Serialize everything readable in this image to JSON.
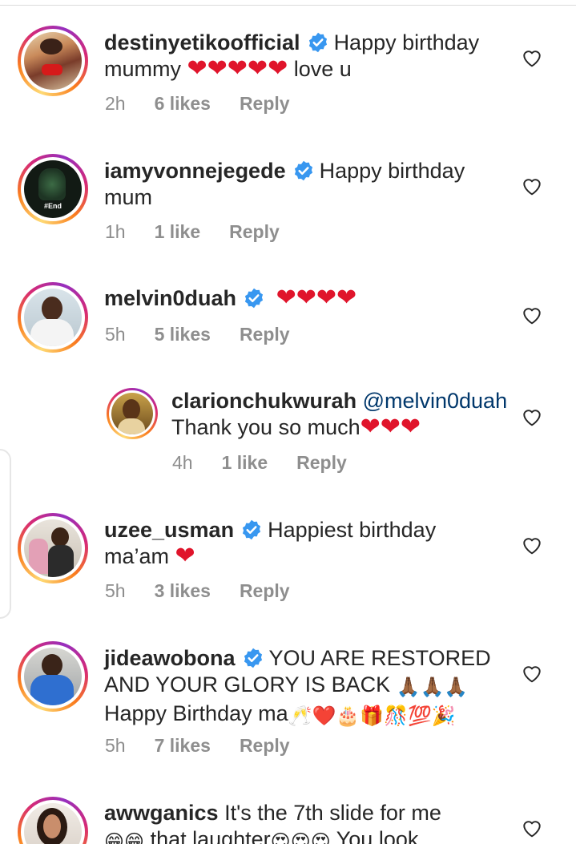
{
  "comments": [
    {
      "username": "destinyetikoofficial",
      "line1": "Happy birthday",
      "line2_prefix": "mummy",
      "hearts": "❤❤❤❤❤",
      "line2_suffix": "love u",
      "time": "2h",
      "likes": "6 likes",
      "reply": "Reply"
    },
    {
      "username": "iamyvonnejegede",
      "line1": "Happy birthday",
      "line2": "mum",
      "avatar_text": "#End",
      "time": "1h",
      "likes": "1 like",
      "reply": "Reply"
    },
    {
      "username": "melvin0duah",
      "hearts": "❤❤❤❤",
      "time": "5h",
      "likes": "5 likes",
      "reply": "Reply"
    },
    {
      "username": "clarionchukwurah",
      "mention": "@melvin0duah",
      "line2": "Thank you so much",
      "hearts": "❤❤❤",
      "time": "4h",
      "likes": "1 like",
      "reply": "Reply"
    },
    {
      "username": "uzee_usman",
      "line1": "Happiest birthday",
      "line2": "ma’am",
      "hearts": "❤",
      "time": "5h",
      "likes": "3 likes",
      "reply": "Reply"
    },
    {
      "username": "jideawobona",
      "line1": "YOU ARE RESTORED",
      "line2": "AND YOUR GLORY IS BACK",
      "line2_emoji": "🙏🏾🙏🏾🙏🏾",
      "line3": "Happy Birthday ma",
      "line3_emoji": "🥂❤️🎂🎁🎊💯🎉",
      "time": "5h",
      "likes": "7 likes",
      "reply": "Reply"
    },
    {
      "username": "awwganics",
      "line1": "It's the 7th slide for me",
      "line2_emoji1": "😁😁",
      "line2": "that laughter",
      "line2_emoji2": "😍😍😍",
      "line2_suffix": "You look"
    }
  ],
  "icons": {
    "verified": "verified-badge-icon",
    "like": "heart-outline-icon"
  },
  "colors": {
    "heart_red": "#e0142b",
    "verified_blue": "#3897f0",
    "meta_grey": "#8e8e8e",
    "mention_blue": "#00376b"
  }
}
